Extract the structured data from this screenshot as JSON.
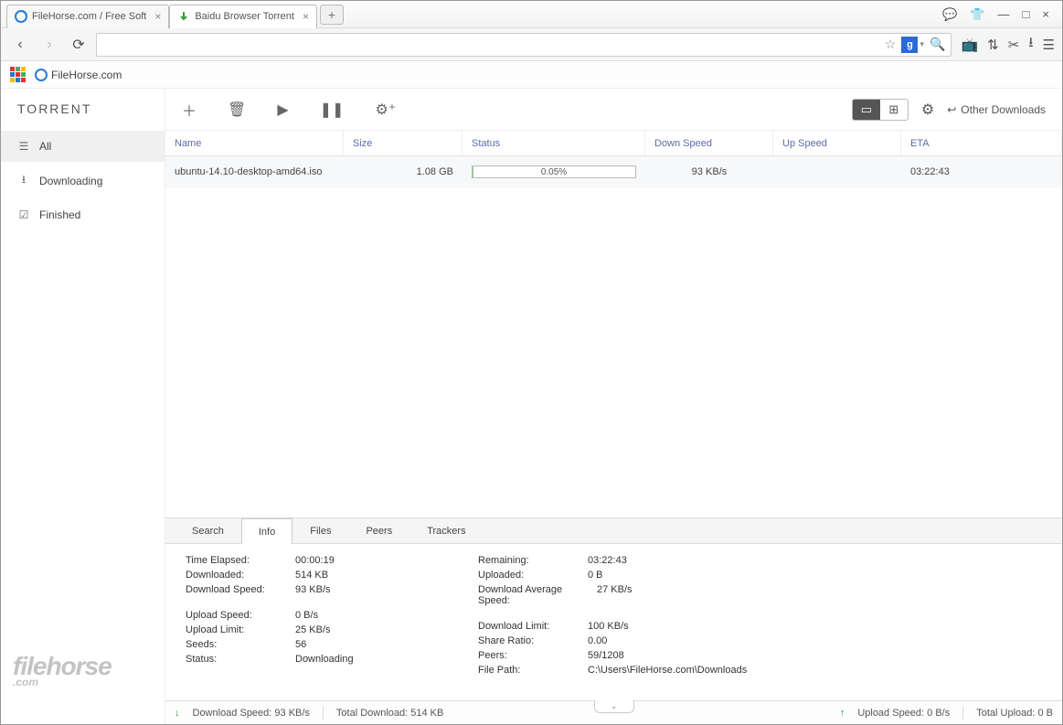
{
  "tabs": [
    {
      "label": "FileHorse.com / Free Soft",
      "active": false
    },
    {
      "label": "Baidu Browser Torrent",
      "active": true
    }
  ],
  "bookmarks": {
    "filehorse": "FileHorse.com"
  },
  "torrent": {
    "title": "TORRENT",
    "other_downloads": "Other Downloads",
    "sidebar": {
      "all": "All",
      "downloading": "Downloading",
      "finished": "Finished"
    },
    "columns": {
      "name": "Name",
      "size": "Size",
      "status": "Status",
      "down": "Down Speed",
      "up": "Up Speed",
      "eta": "ETA"
    },
    "rows": [
      {
        "name": "ubuntu-14.10-desktop-amd64.iso",
        "size": "1.08 GB",
        "progress_pct": "0.05%",
        "down": "93 KB/s",
        "up": "",
        "eta": "03:22:43"
      }
    ],
    "detail_tabs": {
      "search": "Search",
      "info": "Info",
      "files": "Files",
      "peers": "Peers",
      "trackers": "Trackers"
    },
    "info": {
      "time_elapsed_l": "Time Elapsed:",
      "time_elapsed": "00:00:19",
      "downloaded_l": "Downloaded:",
      "downloaded": "514 KB",
      "dl_speed_l": "Download Speed:",
      "dl_speed": "93 KB/s",
      "ul_speed_l": "Upload Speed:",
      "ul_speed": "0 B/s",
      "ul_limit_l": "Upload Limit:",
      "ul_limit": "25 KB/s",
      "seeds_l": "Seeds:",
      "seeds": "56",
      "status_l": "Status:",
      "status": "Downloading",
      "remaining_l": "Remaining:",
      "remaining": "03:22:43",
      "uploaded_l": "Uploaded:",
      "uploaded": "0 B",
      "dl_avg_l": "Download Average Speed:",
      "dl_avg": "27 KB/s",
      "dl_limit_l": "Download Limit:",
      "dl_limit": "100 KB/s",
      "ratio_l": "Share Ratio:",
      "ratio": "0.00",
      "peers_l": "Peers:",
      "peers": "59/1208",
      "path_l": "File Path:",
      "path": "C:\\Users\\FileHorse.com\\Downloads"
    },
    "status": {
      "dl_speed_lbl": "Download Speed: 93 KB/s",
      "total_dl": "Total Download: 514 KB",
      "ul_speed_lbl": "Upload Speed: 0 B/s",
      "total_ul": "Total Upload: 0 B"
    }
  },
  "g": "g",
  "watermark": {
    "main": "filehorse",
    "sub": ".com"
  }
}
